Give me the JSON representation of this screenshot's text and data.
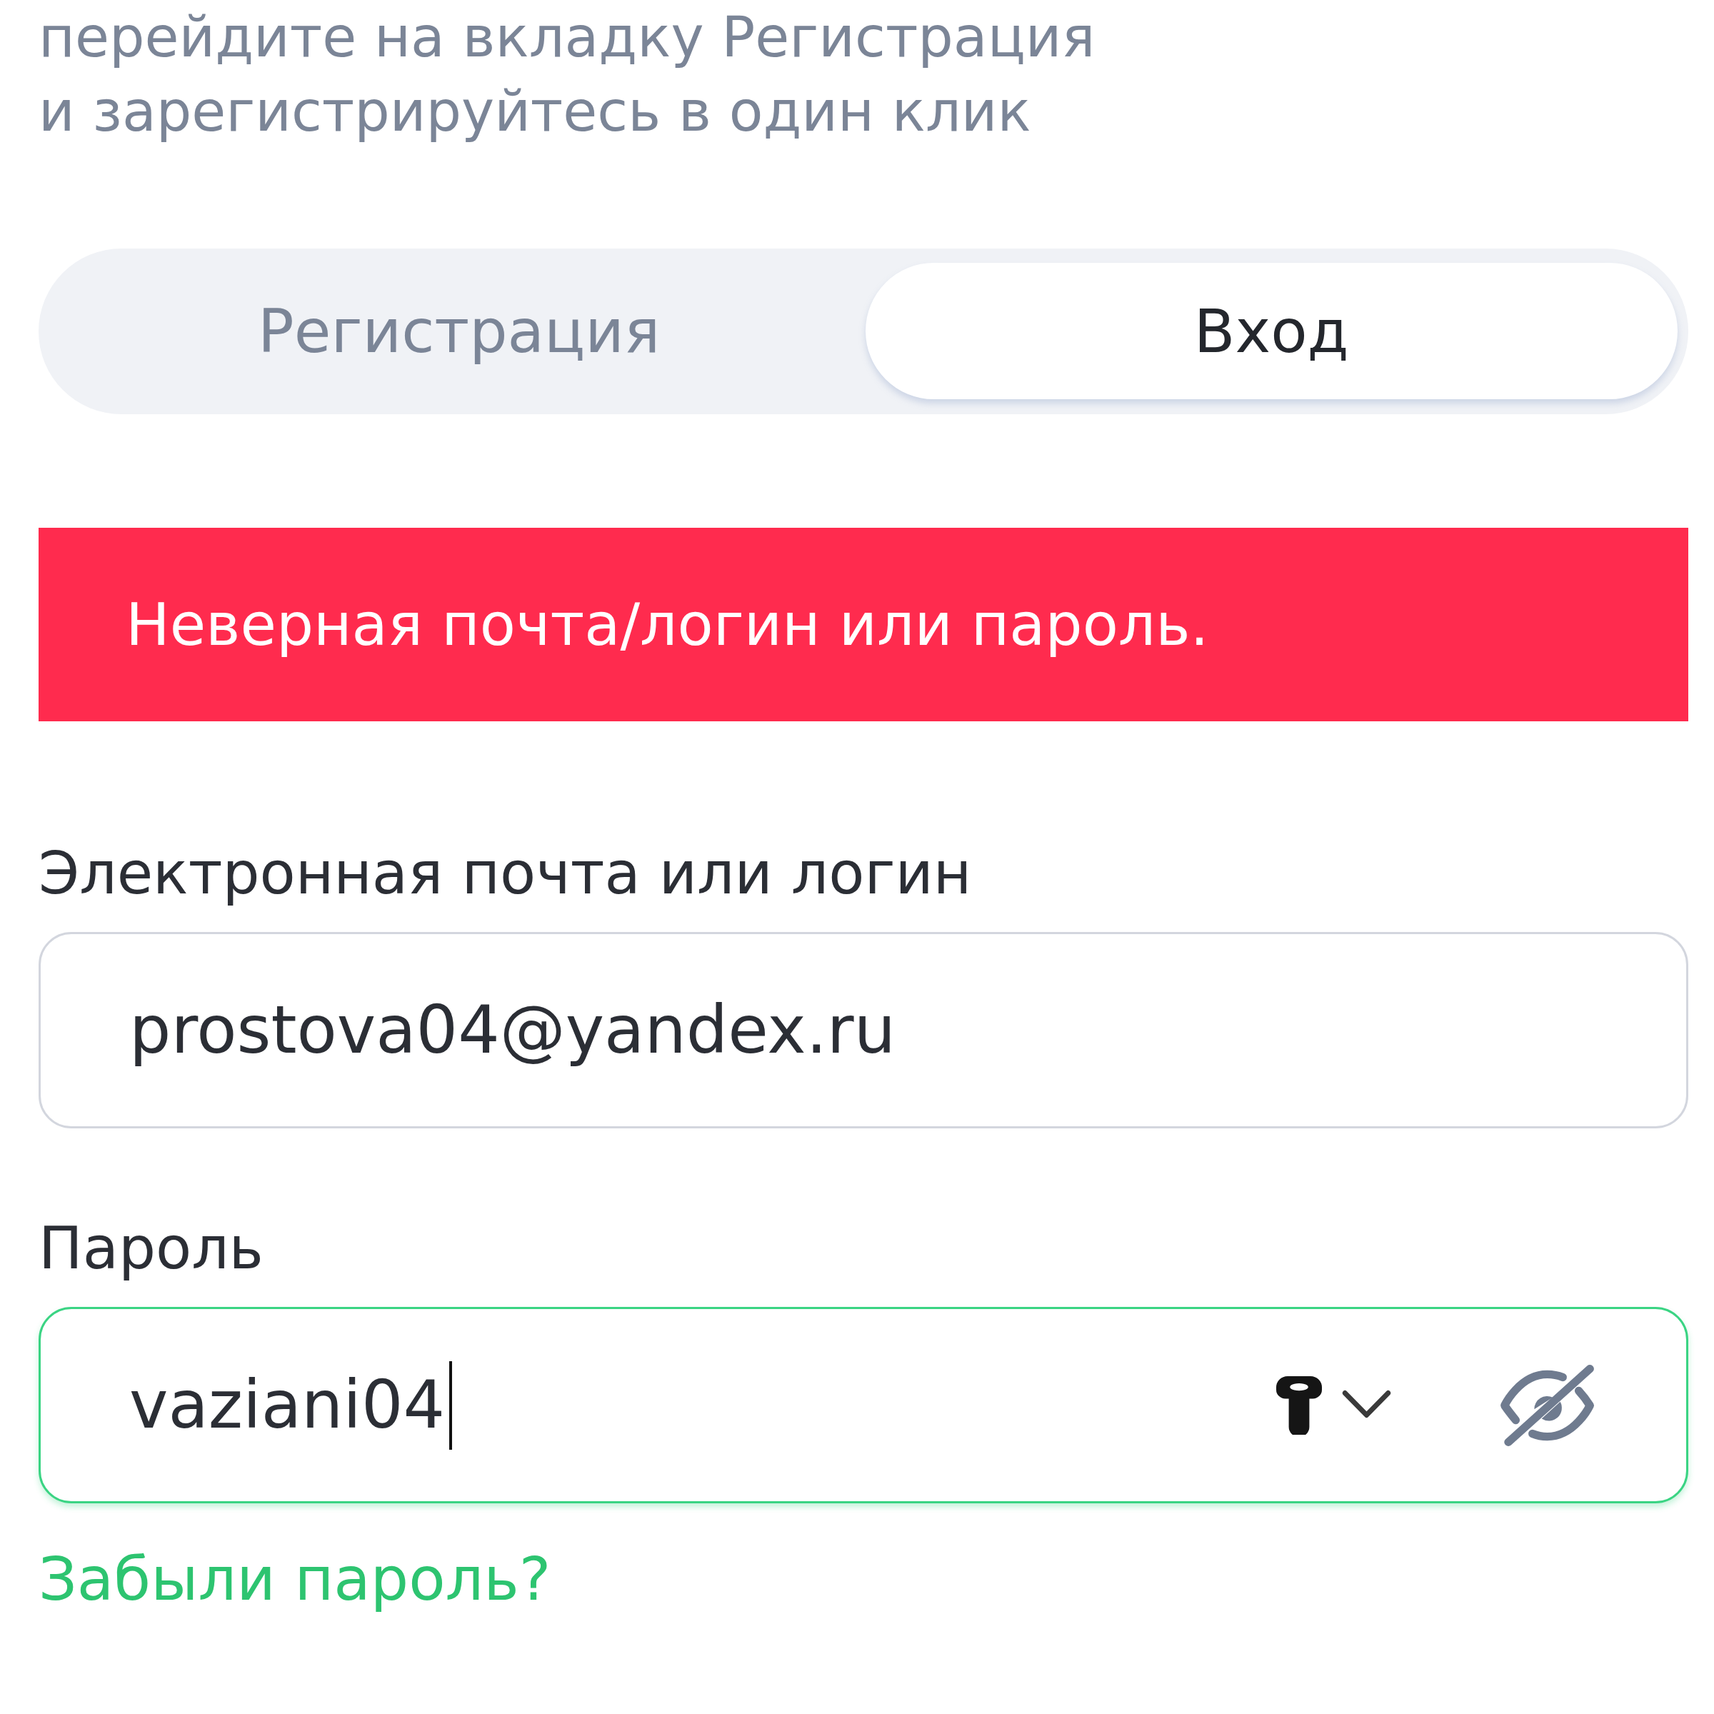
{
  "intro": {
    "lines": [
      "перейдите на вкладку Регистрация",
      "и зарегистрируйтесь в один клик"
    ]
  },
  "tabs": [
    {
      "label": "Регистрация",
      "selected": false
    },
    {
      "label": "Вход",
      "selected": true
    }
  ],
  "alert": {
    "kind": "error",
    "message": "Неверная почта/логин или пароль."
  },
  "fields": [
    {
      "kind": "text",
      "label": "Электронная почта или логин",
      "value": "prostova04@yandex.ru",
      "focused": false
    },
    {
      "kind": "password",
      "label": "Пароль",
      "value": "vaziani04",
      "focused": true
    }
  ],
  "forgot_link": "Забыли пароль?"
}
